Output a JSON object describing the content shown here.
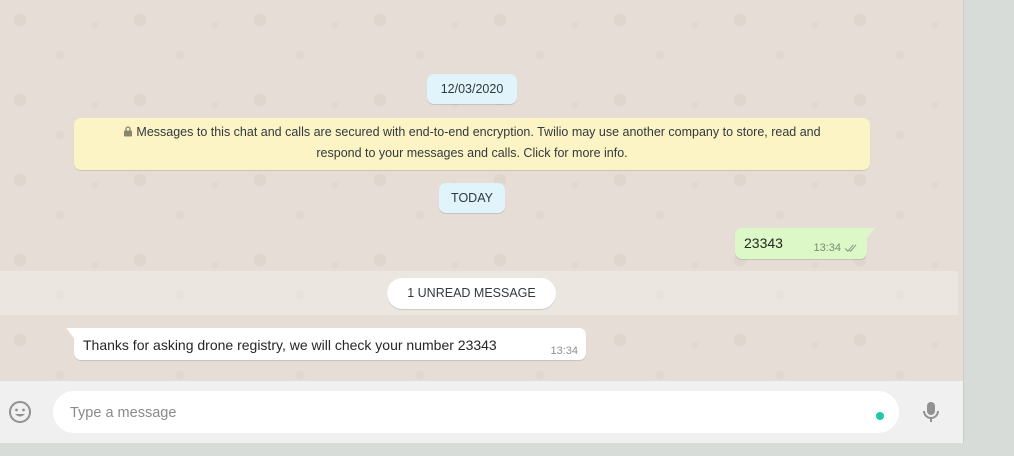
{
  "chat": {
    "date_separator": "12/03/2020",
    "encryption_notice": {
      "line1": "Messages to this chat and calls are secured with end-to-end encryption. Twilio may use another company to store, read and",
      "line2": "respond to your messages and calls. Click for more info."
    },
    "today_separator": "TODAY",
    "outgoing_message": {
      "text": "23343",
      "time": "13:34",
      "status_icon": "double-check-icon"
    },
    "unread_banner": "1 UNREAD MESSAGE",
    "incoming_message": {
      "text": "Thanks for asking drone registry, we will check your number 23343",
      "time": "13:34"
    }
  },
  "composer": {
    "emoji_icon": "emoji-icon",
    "placeholder": "Type a message",
    "value": "",
    "mic_icon": "microphone-icon"
  },
  "colors": {
    "chat_background": "#e5ddd5",
    "outgoing_bubble": "#dcf8c6",
    "incoming_bubble": "#ffffff",
    "system_notice": "#fdf4c5",
    "date_pill": "#e1f3fb",
    "composer_bar": "#f0f0f0",
    "status_dot": "#1cc9a1"
  }
}
